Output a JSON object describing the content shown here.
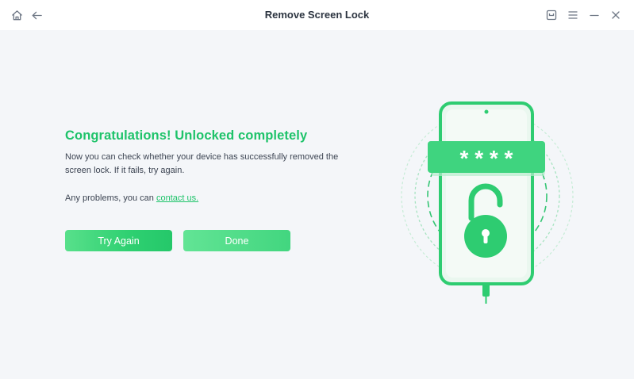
{
  "window": {
    "title": "Remove Screen Lock"
  },
  "titlebar_icons": {
    "home": "home-icon",
    "back": "back-arrow-icon",
    "feedback": "feedback-icon",
    "menu": "menu-icon",
    "minimize": "minimize-icon",
    "close": "close-icon"
  },
  "result": {
    "headline": "Congratulations! Unlocked completely",
    "description": "Now you can check whether your device has successfully removed the screen lock. If it fails, try again.",
    "problem_prefix": "Any problems, you can ",
    "contact_link": "contact us."
  },
  "buttons": {
    "try_again": "Try Again",
    "done": "Done"
  },
  "illustration": {
    "password_mask": "* * * *"
  },
  "colors": {
    "accent": "#1ec36a",
    "background": "#f4f6f9",
    "text": "#3c4452"
  }
}
